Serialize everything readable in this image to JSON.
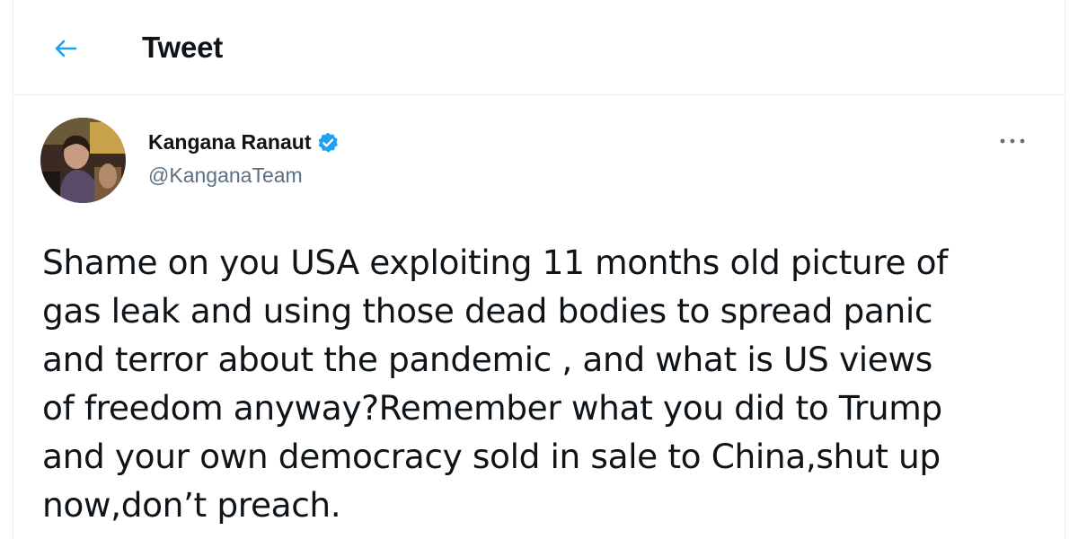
{
  "header": {
    "back_icon": "arrow-left-icon",
    "title": "Tweet"
  },
  "tweet": {
    "author": {
      "display_name": "Kangana Ranaut",
      "handle": "@KanganaTeam",
      "verified": true,
      "verified_icon": "verified-badge-icon"
    },
    "more_icon": "more-horizontal-icon",
    "text": "Shame on you USA exploiting 11 months old picture of\ngas leak and using those dead bodies to spread panic\nand terror about the pandemic , and what is US views\nof freedom anyway?Remember what you did to Trump\nand your own democracy sold in sale to China,shut up\nnow,don’t preach."
  },
  "colors": {
    "accent": "#1da1f2",
    "text_primary": "#0f1419",
    "text_secondary": "#5b7083",
    "border": "#ebeef0"
  }
}
